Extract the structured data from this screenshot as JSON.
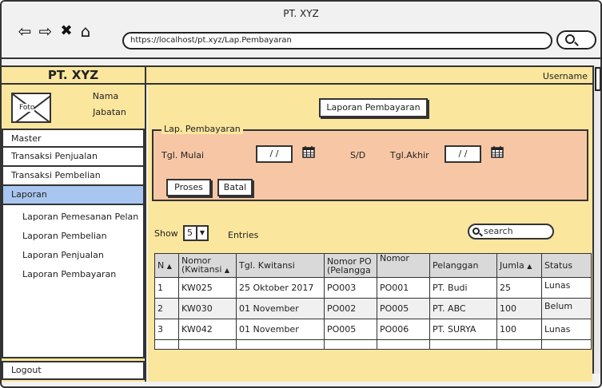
{
  "window": {
    "title": "PT. XYZ"
  },
  "browser": {
    "url": "https://localhost/pt.xyz/Lap.Pembayaran"
  },
  "header": {
    "brand": "PT. XYZ",
    "username": "Username"
  },
  "profile": {
    "photo_label": "Foto",
    "name": "Nama",
    "title": "Jabatan"
  },
  "sidebar": {
    "items": [
      {
        "label": "Master"
      },
      {
        "label": "Transaksi Penjualan"
      },
      {
        "label": "Transaksi Pembelian"
      },
      {
        "label": "Laporan"
      }
    ],
    "subitems": [
      {
        "label": "Laporan Pemesanan Pelan"
      },
      {
        "label": "Laporan Pembelian"
      },
      {
        "label": "Laporan Penjualan"
      },
      {
        "label": "Laporan Pembayaran"
      }
    ],
    "logout": "Logout"
  },
  "main": {
    "report_button": "Laporan Pembayaran",
    "legend": "Lap. Pembayaran",
    "start_label": "Tgl. Mulai",
    "start_value": "/ /",
    "separator": "S/D",
    "end_label": "Tgl.Akhir",
    "end_value": "/ /",
    "process_button": "Proses",
    "cancel_button": "Batal",
    "show_label": "Show",
    "show_value": "5",
    "entries_label": "Entries",
    "search_placeholder": "search"
  },
  "table": {
    "headers": [
      "N",
      "Nomor (Kwitansi",
      "Tgl. Kwitansi",
      "Nomor PO (Pelangga",
      "Nomor",
      "Pelanggan",
      "Jumla",
      "Status"
    ],
    "rows": [
      [
        "1",
        "KW025",
        "25 Oktober 2017",
        "PO003",
        "PO001",
        "PT. Budi",
        "25",
        "Lunas"
      ],
      [
        "2",
        "KW030",
        "01 November",
        "PO002",
        "PO005",
        "PT. ABC",
        "100",
        "Belum"
      ],
      [
        "3",
        "KW042",
        "01 November",
        "PO005",
        "PO006",
        "PT. SURYA",
        "100",
        "Lunas"
      ]
    ]
  },
  "colors": {
    "panel": "#fbe69d",
    "fieldset": "#f7c7a5",
    "active": "#a8c6ef"
  }
}
